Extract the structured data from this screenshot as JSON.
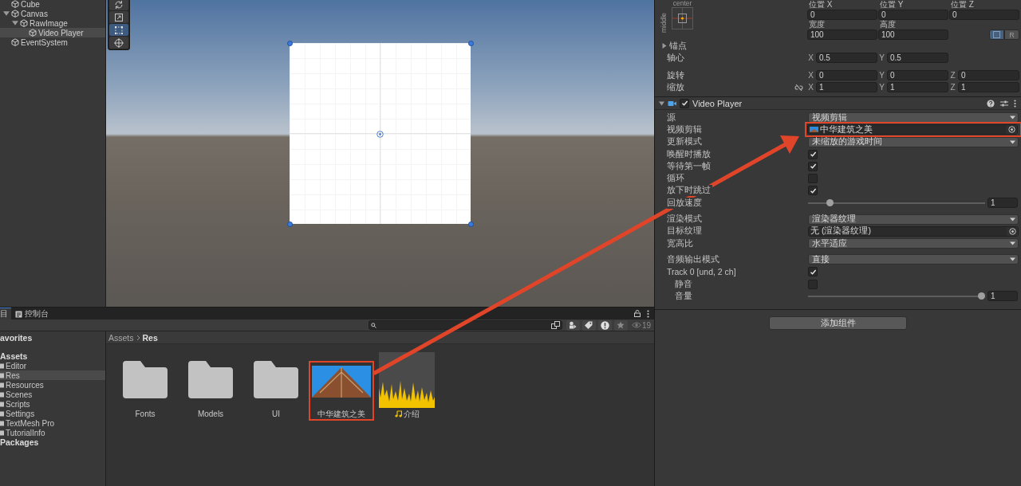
{
  "hierarchy": {
    "items": [
      {
        "label": "Cube",
        "selected": false
      },
      {
        "label": "Canvas",
        "expanded": true,
        "selected": false,
        "children": [
          {
            "label": "RawImage",
            "expanded": true,
            "selected": false,
            "children": [
              {
                "label": "Video Player",
                "selected": true
              }
            ]
          }
        ]
      },
      {
        "label": "EventSystem",
        "selected": false
      }
    ]
  },
  "scene": {
    "tools": [
      {
        "kind": "rotate",
        "selected": false
      },
      {
        "kind": "scale",
        "selected": false
      },
      {
        "kind": "rect",
        "selected": true
      },
      {
        "kind": "transform",
        "selected": false
      }
    ]
  },
  "inspector": {
    "rect_transform": {
      "anchor_preset": {
        "horizontal": "center",
        "vertical": "middle"
      },
      "position": [
        {
          "label": "位置 X",
          "value": "0"
        },
        {
          "label": "位置 Y",
          "value": "0"
        },
        {
          "label": "位置 Z",
          "value": "0"
        }
      ],
      "size": [
        {
          "label": "宽度",
          "value": "100"
        },
        {
          "label": "高度",
          "value": "100"
        }
      ],
      "edit_modes": [
        {
          "kind": "blueprint",
          "selected": true
        },
        {
          "kind": "raw",
          "label": "R",
          "selected": false
        }
      ],
      "anchors": {
        "label": "锚点",
        "expanded": false
      },
      "pivot": {
        "label": "轴心",
        "fields": [
          {
            "axis": "X",
            "value": "0.5"
          },
          {
            "axis": "Y",
            "value": "0.5"
          }
        ]
      },
      "transform_rows": [
        {
          "label": "旋转",
          "kind": "plain",
          "fields": [
            {
              "axis": "X",
              "value": "0"
            },
            {
              "axis": "Y",
              "value": "0"
            },
            {
              "axis": "Z",
              "value": "0"
            }
          ]
        },
        {
          "label": "缩放",
          "kind": "linked",
          "fields": [
            {
              "axis": "X",
              "value": "1"
            },
            {
              "axis": "Y",
              "value": "1"
            },
            {
              "axis": "Z",
              "value": "1"
            }
          ]
        }
      ]
    },
    "video_player": {
      "title": "Video Player",
      "enabled": true,
      "expanded": true,
      "groups": [
        [
          {
            "label": "源",
            "kind": "dropdown",
            "value": "视频剪辑"
          },
          {
            "label": "视频剪辑",
            "kind": "object",
            "value": "中华建筑之美",
            "thumbnail": true,
            "highlighted": true
          },
          {
            "label": "更新模式",
            "kind": "dropdown",
            "value": "未缩放的游戏时间"
          },
          {
            "label": "唤醒时播放",
            "kind": "checkbox",
            "checked": true
          },
          {
            "label": "等待第一帧",
            "kind": "checkbox",
            "checked": true
          },
          {
            "label": "循环",
            "kind": "checkbox",
            "checked": false
          },
          {
            "label": "放下时跳过",
            "kind": "checkbox",
            "checked": true
          },
          {
            "label": "回放速度",
            "kind": "slider",
            "level": 0.11,
            "reading": "1"
          }
        ],
        [
          {
            "label": "渲染模式",
            "kind": "dropdown",
            "value": "渲染器纹理"
          },
          {
            "label": "目标纹理",
            "kind": "object",
            "value": "无 (渲染器纹理)",
            "thumbnail": false,
            "highlighted": false
          },
          {
            "label": "宽高比",
            "kind": "dropdown",
            "value": "水平适应"
          }
        ],
        [
          {
            "label": "音频输出模式",
            "kind": "dropdown",
            "value": "直接"
          },
          {
            "label": "Track 0 [und, 2 ch]",
            "kind": "checkbox",
            "checked": true,
            "children": [
              {
                "label": "静音",
                "kind": "checkbox",
                "checked": false
              },
              {
                "label": "音量",
                "kind": "slider",
                "level": 1,
                "reading": "1"
              }
            ]
          }
        ]
      ]
    },
    "add_component_button": "添加组件"
  },
  "project": {
    "tabs": [
      {
        "label": "目",
        "selected": true
      },
      {
        "label": "控制台",
        "selected": false
      }
    ],
    "count": "19",
    "sections": [
      {
        "label": "avorites"
      },
      {
        "label": "Assets",
        "children": [
          {
            "label": "Editor",
            "selected": false
          },
          {
            "label": "Res",
            "selected": true
          },
          {
            "label": "Resources",
            "selected": false
          },
          {
            "label": "Scenes",
            "selected": false
          },
          {
            "label": "Scripts",
            "selected": false
          },
          {
            "label": "Settings",
            "selected": false
          },
          {
            "label": "TextMesh Pro",
            "selected": false
          },
          {
            "label": "TutorialInfo",
            "selected": false
          }
        ]
      },
      {
        "label": "Packages"
      }
    ],
    "breadcrumb": [
      "Assets",
      "Res"
    ],
    "assets": [
      {
        "label": "Fonts",
        "kind": "folder",
        "highlighted": false
      },
      {
        "label": "Models",
        "kind": "folder",
        "highlighted": false
      },
      {
        "label": "UI",
        "kind": "folder",
        "highlighted": false
      },
      {
        "label": "中华建筑之美",
        "kind": "video",
        "highlighted": true
      },
      {
        "label": "介绍",
        "kind": "audio",
        "highlighted": false
      }
    ]
  }
}
